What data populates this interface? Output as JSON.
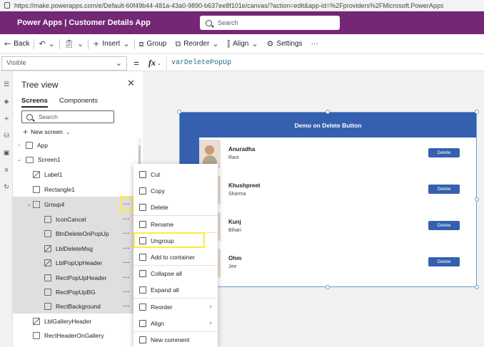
{
  "browser": {
    "url": "https://make.powerapps.com/e/Default-60f49b44-481a-43a0-9890-b637ee8f101e/canvas/?action=edit&app-id=%2Fproviders%2FMicrosoft.PowerApps"
  },
  "header": {
    "brand": "Power Apps  |  Customer Details App",
    "search_placeholder": "Search"
  },
  "toolbar": {
    "back": "Back",
    "insert": "Insert",
    "group": "Group",
    "reorder": "Reorder",
    "align": "Align",
    "settings": "Settings",
    "more": "···"
  },
  "formula": {
    "property": "Visible",
    "equals": "=",
    "fx": "fx",
    "expression": "varDeletePopUp"
  },
  "tree": {
    "title": "Tree view",
    "tabs": [
      "Screens",
      "Components"
    ],
    "search_placeholder": "Search",
    "new_screen": "New screen",
    "nodes": [
      {
        "label": "App"
      },
      {
        "label": "Screen1"
      },
      {
        "label": "Label1"
      },
      {
        "label": "Rectangle1"
      },
      {
        "label": "Group4"
      },
      {
        "label": "IconCancel"
      },
      {
        "label": "BtnDeleteOnPopUp"
      },
      {
        "label": "LblDeleteMsg"
      },
      {
        "label": "LblPopUpHeader"
      },
      {
        "label": "RectPopUpHeader"
      },
      {
        "label": "RectPopUpBG"
      },
      {
        "label": "RectBackground"
      },
      {
        "label": "LblGalleryHeader"
      },
      {
        "label": "RectHeaderOnGallery"
      }
    ]
  },
  "context_menu": {
    "items": [
      "Cut",
      "Copy",
      "Delete",
      "Rename",
      "Ungroup",
      "Add to container",
      "Collapse all",
      "Expand all",
      "Reorder",
      "Align",
      "New comment"
    ]
  },
  "app": {
    "header": "Demo on Delete Button",
    "delete_label": "Delete",
    "rows": [
      {
        "name": "Anuradha",
        "last": "Rani"
      },
      {
        "name": "Khushpreet",
        "last": "Sharma"
      },
      {
        "name": "Kunj",
        "last": "Bihari"
      },
      {
        "name": "Ohm",
        "last": "Jee"
      }
    ]
  },
  "colors": {
    "brand": "#742774",
    "accent": "#3560b0",
    "highlight": "#ffeb3b"
  }
}
